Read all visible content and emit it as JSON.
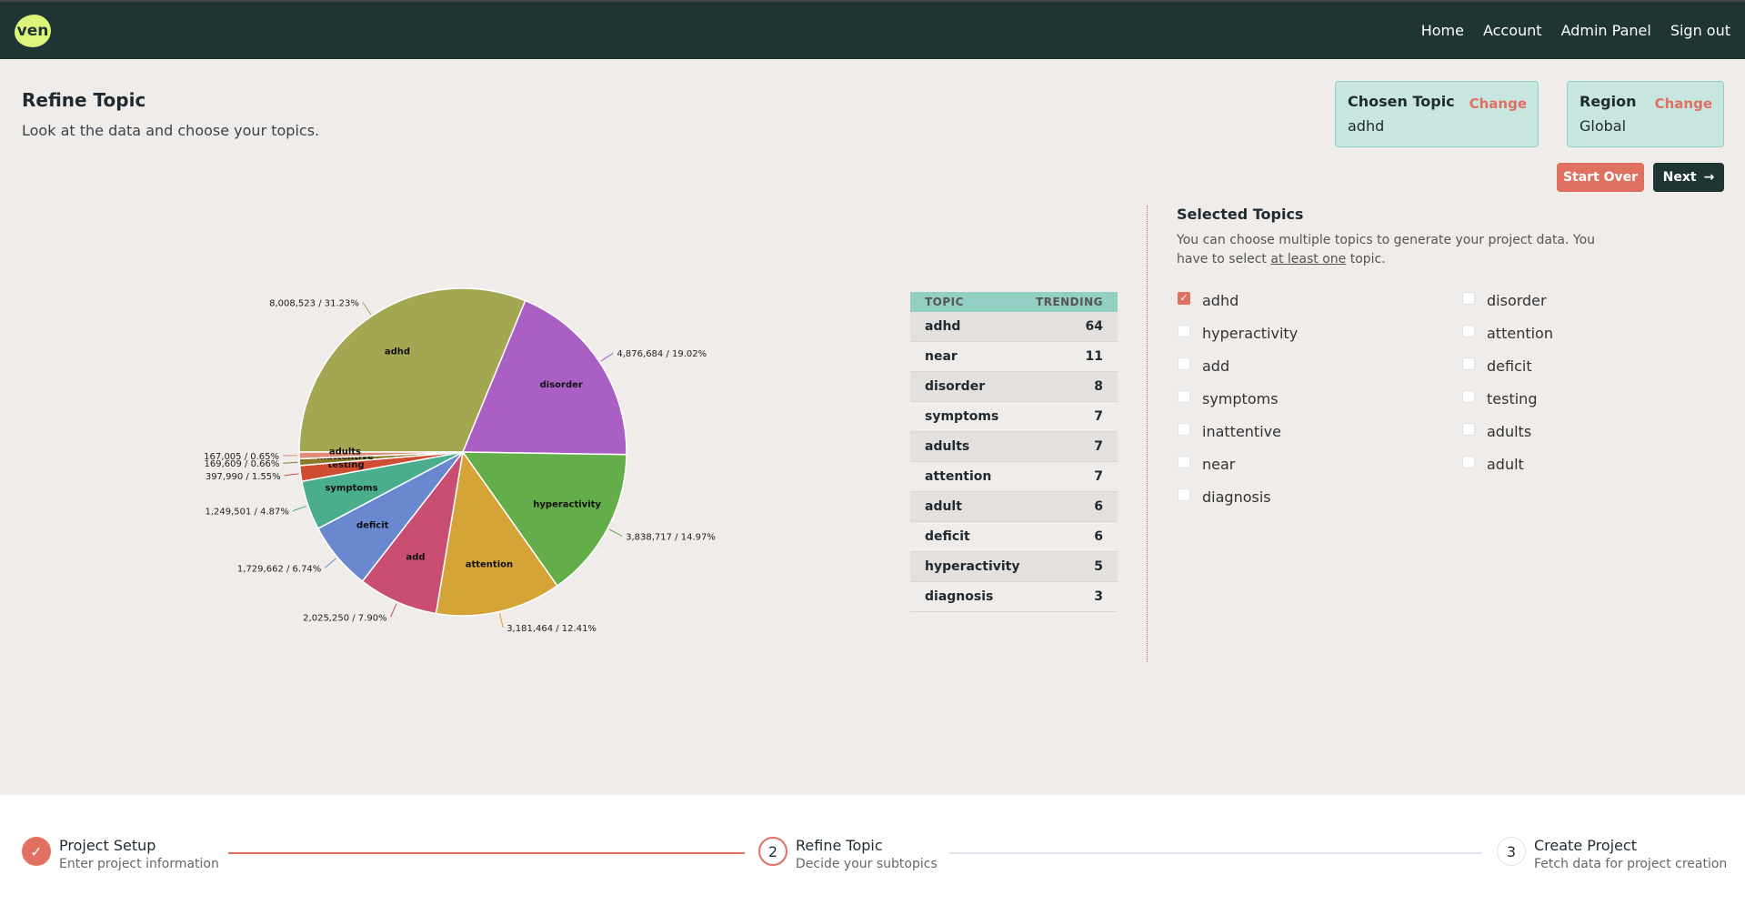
{
  "header": {
    "logo": "ven",
    "nav": [
      "Home",
      "Account",
      "Admin Panel",
      "Sign out"
    ]
  },
  "page": {
    "title": "Refine Topic",
    "subtitle": "Look at the data and choose your topics."
  },
  "chosen_topic": {
    "label": "Chosen Topic",
    "change": "Change",
    "value": "adhd"
  },
  "region": {
    "label": "Region",
    "change": "Change",
    "value": "Global"
  },
  "buttons": {
    "start_over": "Start Over",
    "next": "Next",
    "next_icon": "arrow-right-icon"
  },
  "colors": {
    "accent": "#e07060",
    "header": "#1e3533",
    "table_header": "#93cfc2"
  },
  "chart_data": {
    "type": "pie",
    "start": "9 o'clock, clockwise",
    "slices": [
      {
        "label": "adhd",
        "value": 8008523,
        "value_text": "8,008,523 / 31.23%",
        "percent": 31.23,
        "color": "#a3a752"
      },
      {
        "label": "disorder",
        "value": 4876684,
        "value_text": "4,876,684 / 19.02%",
        "percent": 19.02,
        "color": "#a95fc3"
      },
      {
        "label": "hyperactivity",
        "value": 3838717,
        "value_text": "3,838,717 / 14.97%",
        "percent": 14.97,
        "color": "#63ad4a"
      },
      {
        "label": "attention",
        "value": 3181464,
        "value_text": "3,181,464 / 12.41%",
        "percent": 12.41,
        "color": "#d5a436"
      },
      {
        "label": "add",
        "value": 2025250,
        "value_text": "2,025,250 / 7.90%",
        "percent": 7.9,
        "color": "#c94e72"
      },
      {
        "label": "deficit",
        "value": 1729662,
        "value_text": "1,729,662 / 6.74%",
        "percent": 6.74,
        "color": "#6a88d0"
      },
      {
        "label": "symptoms",
        "value": 1249501,
        "value_text": "1,249,501 / 4.87%",
        "percent": 4.87,
        "color": "#4aae8e"
      },
      {
        "label": "testing",
        "value": 397990,
        "value_text": "397,990 / 1.55%",
        "percent": 1.55,
        "color": "#cf4d33"
      },
      {
        "label": "inattentive",
        "value": 169609,
        "value_text": "169,609 / 0.66%",
        "percent": 0.66,
        "color": "#8a7a2a"
      },
      {
        "label": "adults",
        "value": 167005,
        "value_text": "167,005 / 0.65%",
        "percent": 0.65,
        "color": "#e08a78"
      }
    ]
  },
  "table": {
    "headers": [
      "TOPIC",
      "TRENDING"
    ],
    "rows": [
      [
        "adhd",
        "64"
      ],
      [
        "near",
        "11"
      ],
      [
        "disorder",
        "8"
      ],
      [
        "symptoms",
        "7"
      ],
      [
        "adults",
        "7"
      ],
      [
        "attention",
        "7"
      ],
      [
        "adult",
        "6"
      ],
      [
        "deficit",
        "6"
      ],
      [
        "hyperactivity",
        "5"
      ],
      [
        "diagnosis",
        "3"
      ]
    ]
  },
  "selected": {
    "title": "Selected Topics",
    "desc": "You can choose multiple topics to generate your project data. You have to select ",
    "link": "at least one",
    "desc_end": " topic.",
    "col1": [
      {
        "label": "adhd",
        "checked": true
      },
      {
        "label": "hyperactivity",
        "checked": false
      },
      {
        "label": "add",
        "checked": false
      },
      {
        "label": "symptoms",
        "checked": false
      },
      {
        "label": "inattentive",
        "checked": false
      },
      {
        "label": "near",
        "checked": false
      },
      {
        "label": "diagnosis",
        "checked": false
      }
    ],
    "col2": [
      {
        "label": "disorder",
        "checked": false
      },
      {
        "label": "attention",
        "checked": false
      },
      {
        "label": "deficit",
        "checked": false
      },
      {
        "label": "testing",
        "checked": false
      },
      {
        "label": "adults",
        "checked": false
      },
      {
        "label": "adult",
        "checked": false
      }
    ]
  },
  "stepper": [
    {
      "title": "Project Setup",
      "desc": "Enter project information",
      "state": "done"
    },
    {
      "num": "2",
      "title": "Refine Topic",
      "desc": "Decide your subtopics",
      "state": "current"
    },
    {
      "num": "3",
      "title": "Create Project",
      "desc": "Fetch data for project creation",
      "state": "todo"
    }
  ]
}
